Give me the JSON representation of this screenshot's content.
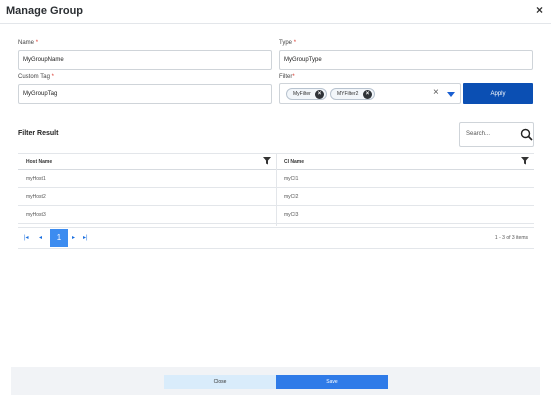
{
  "dialog": {
    "title": "Manage Group",
    "close_glyph": "×"
  },
  "form": {
    "name": {
      "label": "Name",
      "required_mark": "*",
      "value": "MyGroupName"
    },
    "type": {
      "label": "Type",
      "required_mark": "*",
      "value": "MyGroupType"
    },
    "custom_tag": {
      "label": "Custom Tag",
      "required_mark": "*",
      "value": "MyGroupTag"
    },
    "filter": {
      "label": "Filter",
      "required_mark": "*",
      "chips": [
        {
          "label": "MyFilter"
        },
        {
          "label": "MYFilter2"
        }
      ],
      "chip_remove_glyph": "×",
      "clear_glyph": "×"
    },
    "apply_label": "Apply"
  },
  "results": {
    "title": "Filter Result",
    "search_placeholder": "Search...",
    "columns": [
      "Host Name",
      "CI Name"
    ],
    "rows": [
      [
        "myHost1",
        "myCI1"
      ],
      [
        "myHost2",
        "myCI2"
      ],
      [
        "myHost3",
        "myCI3"
      ]
    ],
    "pager": {
      "first": "|◂",
      "prev": "◂",
      "current_page": "1",
      "next": "▸",
      "last": "▸|",
      "info": "1 - 3 of 3 items"
    }
  },
  "footer": {
    "close_label": "Close",
    "save_label": "Save"
  },
  "colors": {
    "primary": "#0b4fb3",
    "save": "#2f7be8",
    "close_bg": "#d9ecfb",
    "required": "#d93025"
  },
  "icons": [
    "close-icon",
    "chip-remove-icon",
    "clear-icon",
    "dropdown-caret-icon",
    "search-icon",
    "filter-icon",
    "first-page-icon",
    "prev-page-icon",
    "next-page-icon",
    "last-page-icon"
  ]
}
